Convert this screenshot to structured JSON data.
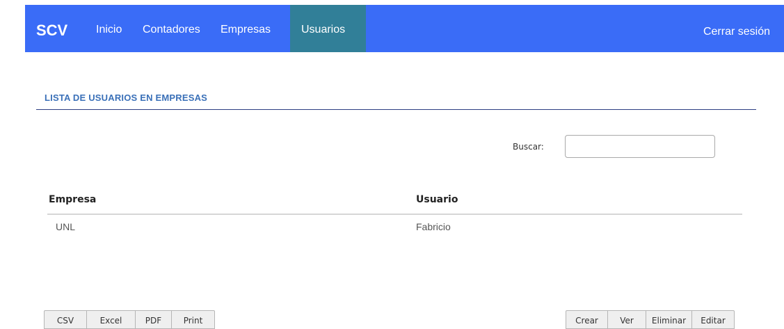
{
  "navbar": {
    "brand": "SCV",
    "items": [
      {
        "label": "Inicio"
      },
      {
        "label": "Contadores"
      },
      {
        "label": "Empresas"
      },
      {
        "label": "Usuarios",
        "active": true
      }
    ],
    "logout": "Cerrar sesión",
    "colors": {
      "background": "#3a6cf7",
      "active": "#317f98"
    }
  },
  "page": {
    "title": "LISTA DE USUARIOS EN EMPRESAS",
    "title_color": "#3a70b8"
  },
  "search": {
    "label": "Buscar:",
    "value": "",
    "placeholder": ""
  },
  "table": {
    "columns": [
      "Empresa",
      "Usuario"
    ],
    "rows": [
      [
        "UNL",
        "Fabricio"
      ]
    ]
  },
  "export_buttons": [
    "CSV",
    "Excel",
    "PDF",
    "Print"
  ],
  "action_buttons": [
    "Crear",
    "Ver",
    "Eliminar",
    "Editar"
  ]
}
